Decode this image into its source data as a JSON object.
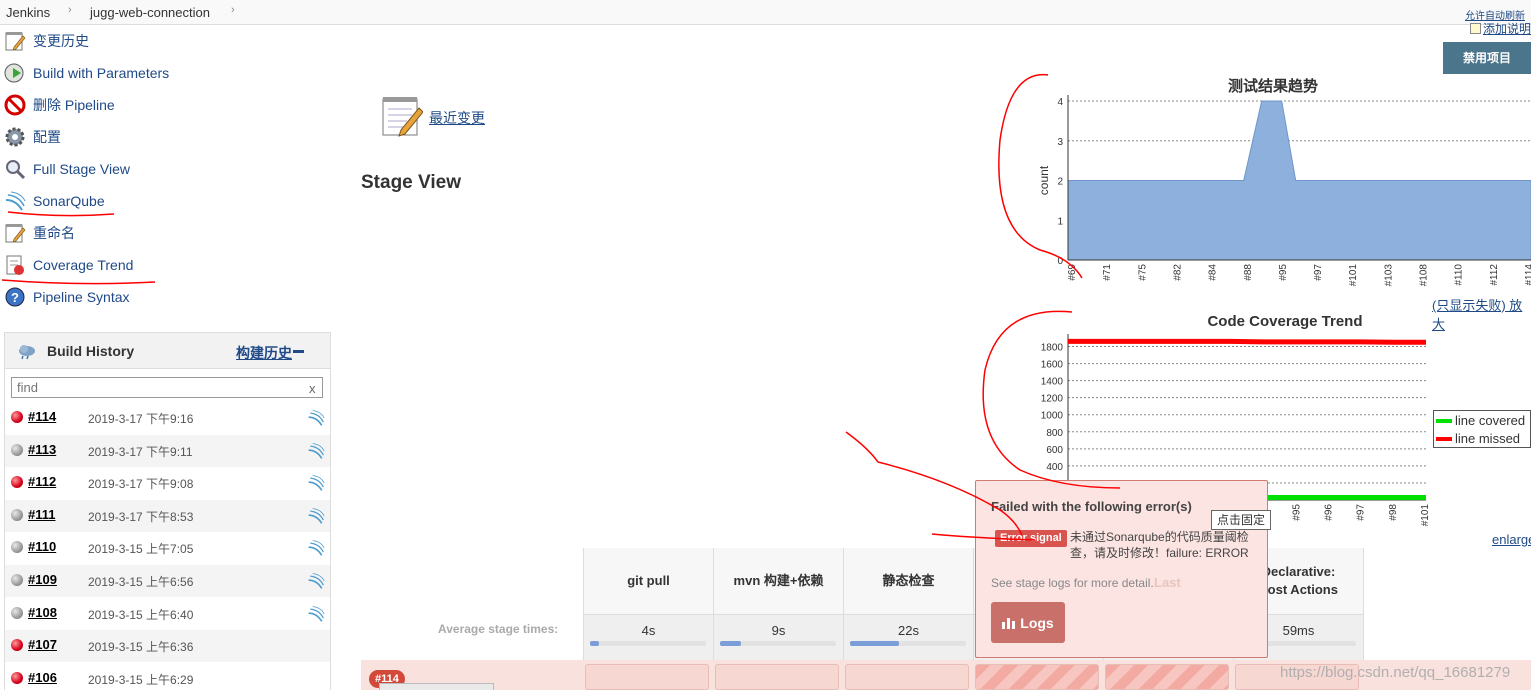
{
  "breadcrumb": {
    "home": "Jenkins",
    "project": "jugg-web-connection"
  },
  "header": {
    "auto_refresh": "允许自动刷新",
    "add_description": "添加说明",
    "disable_project": "禁用项目"
  },
  "tasks": [
    {
      "label": "变更历史",
      "icon": "notepad-icon"
    },
    {
      "label": "Build with Parameters",
      "icon": "clock-play-icon"
    },
    {
      "label": "删除 Pipeline",
      "icon": "no-entry-icon"
    },
    {
      "label": "配置",
      "icon": "gear-icon"
    },
    {
      "label": "Full Stage View",
      "icon": "magnifier-icon"
    },
    {
      "label": "SonarQube",
      "icon": "sonarqube-icon"
    },
    {
      "label": "重命名",
      "icon": "notepad-icon"
    },
    {
      "label": "Coverage Trend",
      "icon": "coverage-report-icon"
    },
    {
      "label": "Pipeline Syntax",
      "icon": "help-icon"
    }
  ],
  "build_history": {
    "title": "Build History",
    "trend_link": "构建历史",
    "search_placeholder": "find",
    "clear": "x",
    "builds": [
      {
        "number": "#114",
        "date": "2019-3-17 下午9:16",
        "status": "failed"
      },
      {
        "number": "#113",
        "date": "2019-3-17 下午9:11",
        "status": "aborted"
      },
      {
        "number": "#112",
        "date": "2019-3-17 下午9:08",
        "status": "failed"
      },
      {
        "number": "#111",
        "date": "2019-3-17 下午8:53",
        "status": "aborted"
      },
      {
        "number": "#110",
        "date": "2019-3-15 上午7:05",
        "status": "aborted"
      },
      {
        "number": "#109",
        "date": "2019-3-15 上午6:56",
        "status": "aborted"
      },
      {
        "number": "#108",
        "date": "2019-3-15 上午6:40",
        "status": "aborted"
      },
      {
        "number": "#107",
        "date": "2019-3-15 上午6:36",
        "status": "failed"
      },
      {
        "number": "#106",
        "date": "2019-3-15 上午6:29",
        "status": "failed"
      }
    ]
  },
  "main": {
    "recent_changes": "最近变更",
    "stage_view_title": "Stage View"
  },
  "chart_links": {
    "failed_only_enlarge": "(只显示失败) 放大",
    "enlarge": "enlarge"
  },
  "colors": {
    "accent": "#204a87",
    "disable_button": "#4b758b",
    "failed": "#d6001c",
    "area_fill": "#8eb0dc",
    "covered": "#00e000",
    "missed": "#ff0000",
    "annotation": "#ff0000"
  },
  "chart_data": [
    {
      "type": "area",
      "title": "测试结果趋势",
      "ylabel": "count",
      "ylim": [
        0,
        4
      ],
      "yticks": [
        0,
        1,
        2,
        3,
        4
      ],
      "x_tick_labels": [
        "#69",
        "#71",
        "#75",
        "#82",
        "#84",
        "#88",
        "#95",
        "#97",
        "#101",
        "#103",
        "#108",
        "#110",
        "#112",
        "#114"
      ],
      "series": [
        {
          "values": [
            2,
            2,
            2,
            2,
            2,
            2,
            4,
            2,
            2,
            2,
            2,
            2,
            2,
            2
          ]
        }
      ]
    },
    {
      "type": "line",
      "title": "Code Coverage Trend",
      "ylim": [
        0,
        1900
      ],
      "yticks": [
        0,
        200,
        400,
        600,
        800,
        1000,
        1200,
        1400,
        1600,
        1800
      ],
      "x_tick_labels": [
        "#88",
        "#89",
        "#90",
        "#91",
        "#92",
        "#93",
        "#94",
        "#95",
        "#96",
        "#97",
        "#98",
        "#101"
      ],
      "legend": "right",
      "series": [
        {
          "name": "line covered",
          "values": [
            30,
            30,
            30,
            30,
            30,
            30,
            30,
            30,
            30,
            30,
            30,
            30
          ]
        },
        {
          "name": "line missed",
          "values": [
            1860,
            1860,
            1860,
            1860,
            1860,
            1860,
            1855,
            1855,
            1855,
            1855,
            1850,
            1850
          ]
        }
      ]
    }
  ],
  "stage_view": {
    "avg_label": "Average stage times:",
    "stages": [
      {
        "name": "git pull",
        "avg": "4s",
        "fill": 0.08
      },
      {
        "name": "mvn 构建+依赖",
        "avg": "9s",
        "fill": 0.18
      },
      {
        "name": "静态检查",
        "avg": "22s",
        "fill": 0.42
      },
      {
        "name": "",
        "avg": "",
        "fill": 0.0
      },
      {
        "name": "",
        "avg": "36ms",
        "fill": 0.0
      },
      {
        "name": "Declarative: Post Actions",
        "avg": "59ms",
        "fill": 0.0
      }
    ],
    "run_badge": "#114"
  },
  "popup": {
    "title": "Failed with the following error(s)",
    "error_tag": "Error signal",
    "error_message": "未通过Sonarqube的代码质量阈检查，请及时修改！failure: ERROR",
    "see_logs": "See stage logs for more detail.",
    "last": "Last",
    "logs_button": "Logs",
    "pin_tooltip": "点击固定"
  },
  "watermark": "https://blog.csdn.net/qq_16681279"
}
